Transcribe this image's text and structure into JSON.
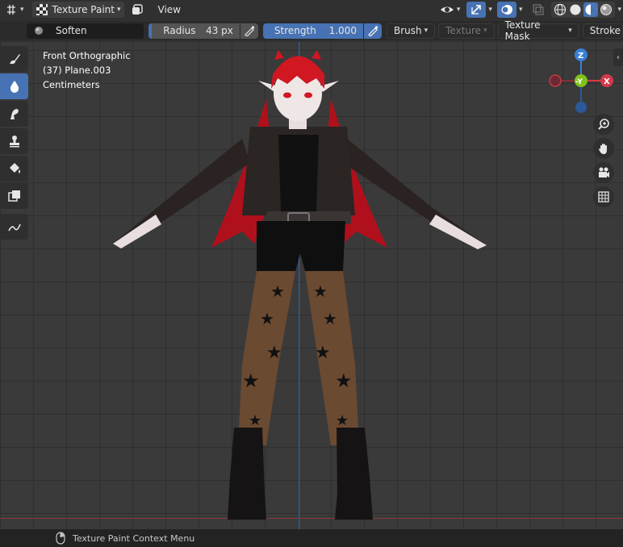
{
  "header": {
    "editor_icon": "grid-transform-icon",
    "mode_label": "Texture Paint",
    "view_menu": "View"
  },
  "toolbar": {
    "brush_name": "Soften",
    "radius_label": "Radius",
    "radius_value": "43 px",
    "strength_label": "Strength",
    "strength_value": "1.000",
    "brush_menu": "Brush",
    "texture_menu": "Texture",
    "texture_mask_menu": "Texture Mask",
    "stroke_menu": "Stroke"
  },
  "viewport": {
    "view_name": "Front Orthographic",
    "object_name": "(37) Plane.003",
    "units": "Centimeters"
  },
  "tools": [
    {
      "name": "draw-tool",
      "icon": "brush-icon",
      "active": false
    },
    {
      "name": "soften-tool",
      "icon": "drop-icon",
      "active": true
    },
    {
      "name": "smear-tool",
      "icon": "smear-icon",
      "active": false
    },
    {
      "name": "clone-tool",
      "icon": "stamp-icon",
      "active": false
    },
    {
      "name": "fill-tool",
      "icon": "bucket-icon",
      "active": false
    },
    {
      "name": "mask-tool",
      "icon": "mask-icon",
      "active": false
    },
    {
      "name": "annotate-tool",
      "icon": "annotate-icon",
      "active": false
    }
  ],
  "gizmo": {
    "z": "Z",
    "y": "-Y",
    "x": "X"
  },
  "colors": {
    "accent": "#4772b3",
    "x_axis": "#d43a4a",
    "y_axis": "#7fc21a",
    "z_axis": "#3a7fd4"
  },
  "status": {
    "context_menu": "Texture Paint Context Menu"
  }
}
